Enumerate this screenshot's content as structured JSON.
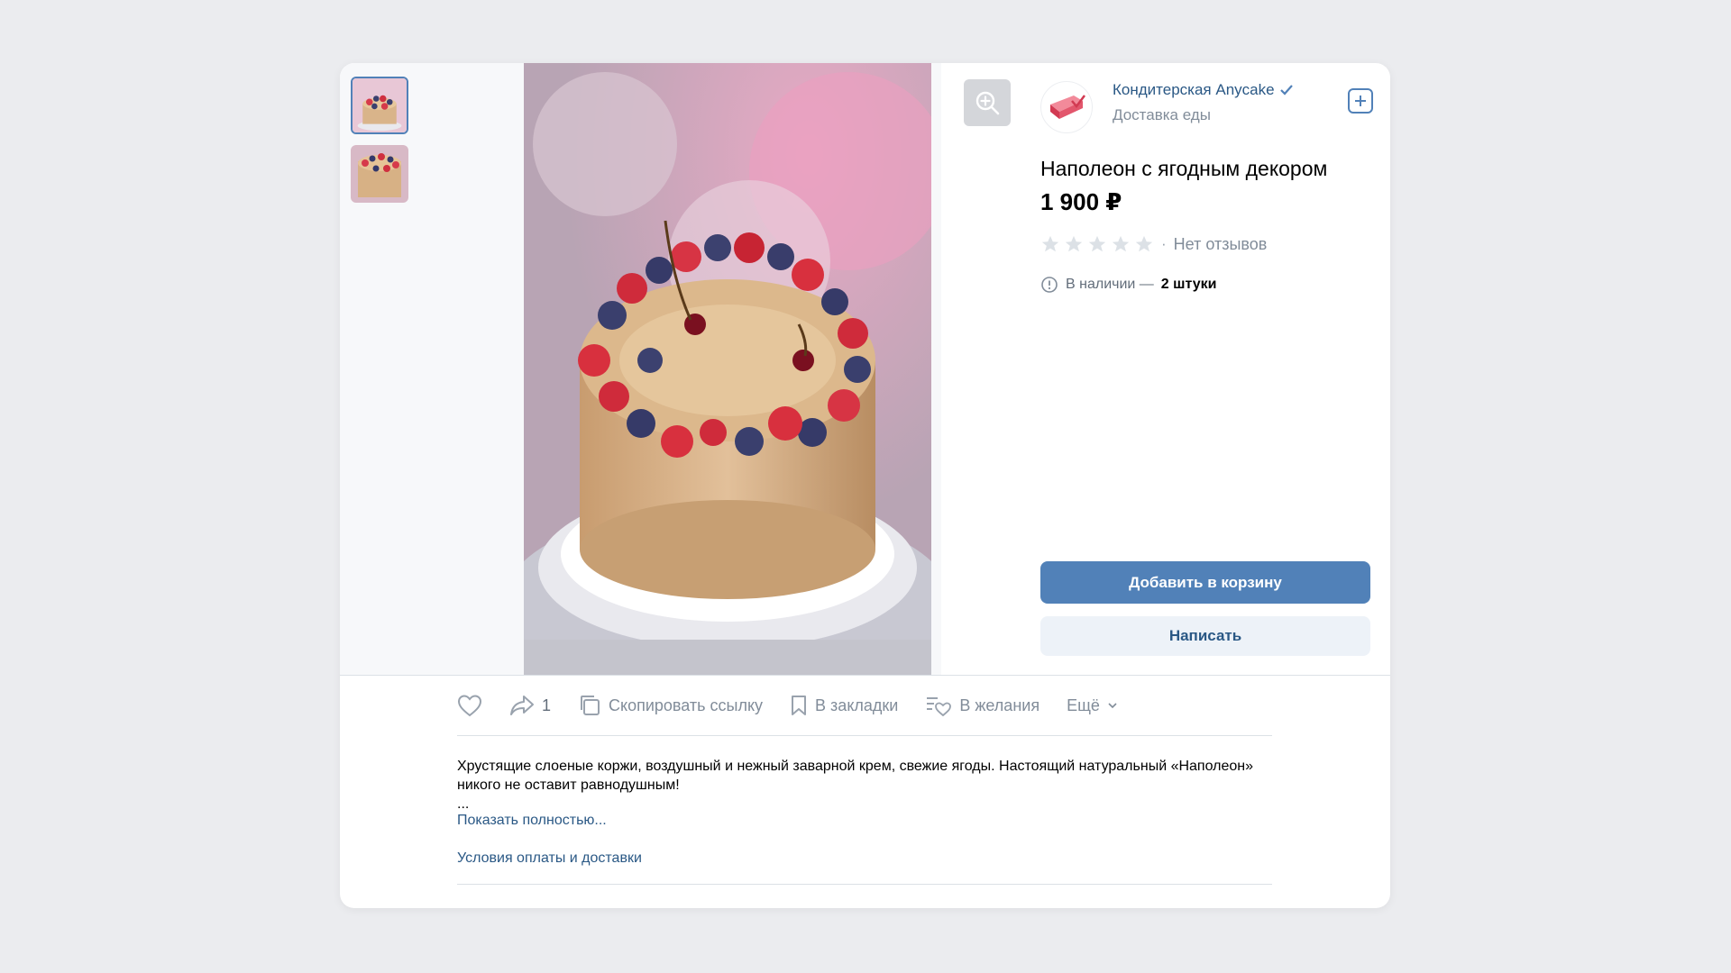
{
  "colors": {
    "accent": "#5181b8",
    "link": "#2a5885",
    "muted": "#818c99"
  },
  "shop": {
    "name": "Кондитерская Anycake",
    "subtitle": "Доставка еды",
    "verified_icon": "check-icon",
    "add_icon": "plus-square-icon"
  },
  "gallery": {
    "thumbnails": [
      "cake-photo-1",
      "cake-photo-2"
    ],
    "active_index": 0,
    "zoom_icon": "zoom-in-icon"
  },
  "product": {
    "title": "Наполеон с ягодным декором",
    "price": "1 900 ₽",
    "rating_stars": 0,
    "rating_max": 5,
    "reviews_sep": "·",
    "reviews_text": "Нет отзывов",
    "stock_label": "В наличии —",
    "stock_value": "2 штуки"
  },
  "buttons": {
    "add_to_cart": "Добавить в корзину",
    "write": "Написать"
  },
  "actions": {
    "like_icon": "heart-icon",
    "share_icon": "share-icon",
    "share_count": "1",
    "copy_link": "Скопировать ссылку",
    "bookmarks": "В закладки",
    "wishlist": "В желания",
    "more": "Ещё"
  },
  "description": {
    "text": "Хрустящие слоеные коржи, воздушный и нежный заварной крем, свежие ягоды. Настоящий натуральный «Наполеон» никого не оставит равнодушным!",
    "ellipsis": "...",
    "show_more": "Показать полностью...",
    "terms_link": "Условия оплаты и доставки"
  }
}
